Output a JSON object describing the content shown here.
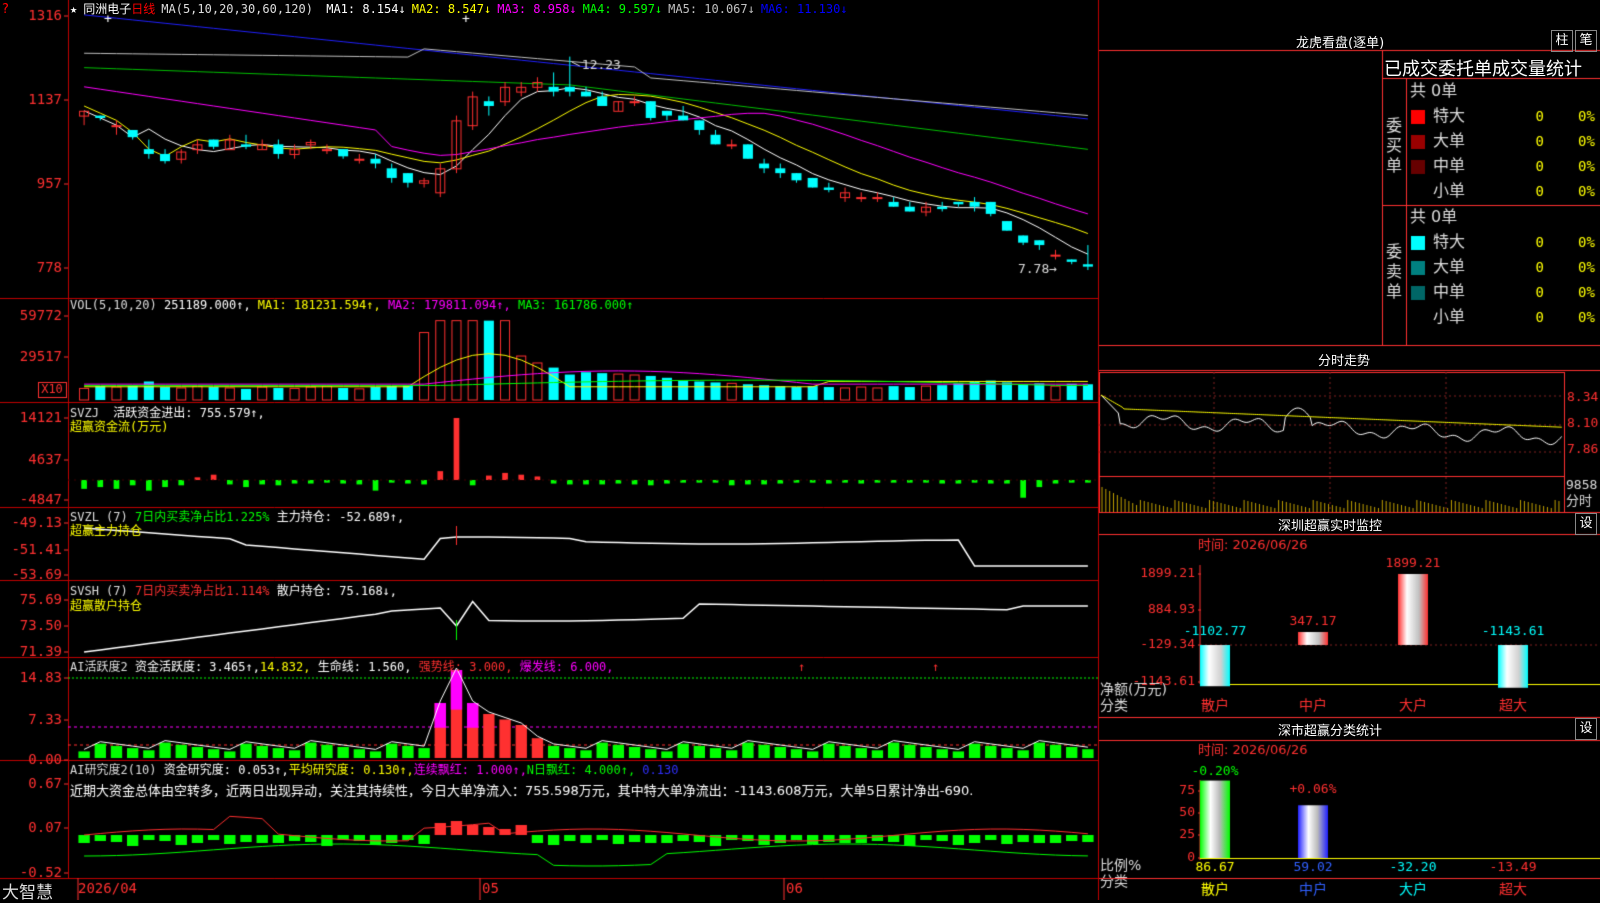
{
  "app": {
    "logo": "大智慧",
    "corner_mark": "?"
  },
  "header": {
    "stock_name": "同洲电子",
    "period": "日线",
    "ma_label": "MA(5,10,20,30,60,120)",
    "ma_values": [
      {
        "name": "MA1",
        "value": "8.154",
        "color": "#ffffff"
      },
      {
        "name": "MA2",
        "value": "8.547",
        "color": "#ffff00"
      },
      {
        "name": "MA3",
        "value": "8.958",
        "color": "#ff00ff"
      },
      {
        "name": "MA4",
        "value": "9.597",
        "color": "#00ff00"
      },
      {
        "name": "MA5",
        "value": "10.067",
        "color": "#c0c0c0"
      },
      {
        "name": "MA6",
        "value": "11.130",
        "color": "#0000ff"
      }
    ]
  },
  "panels": {
    "price": {
      "ticks": [
        "1316",
        "1137",
        "957",
        "778"
      ],
      "high_label": "12.23",
      "low_label": "7.78"
    },
    "vol": {
      "label": "VOL(5,10,20)",
      "value": "251189.000",
      "ma1": "MA1: 181231.594",
      "ma2": "MA2: 179811.094",
      "ma3": "MA3: 161786.000",
      "ticks": [
        "59772",
        "29517"
      ],
      "unit_badge": "X10"
    },
    "svzj": {
      "label": "SVZJ",
      "text": "活跃资金进出: 755.579",
      "sub": "超赢资金流(万元)",
      "ticks": [
        "14121",
        "4637",
        "-4847"
      ]
    },
    "svzl": {
      "label": "SVZL (7)",
      "text1": "7日内买卖净占比1.225%",
      "text2": "主力持仓: -52.689",
      "sub": "超赢主力持仓",
      "ticks": [
        "-49.13",
        "-51.41",
        "-53.69"
      ]
    },
    "svsh": {
      "label": "SVSH (7)",
      "text1": "7日内买卖净占比1.114%",
      "text2": "散户持仓: 75.168",
      "sub": "超赢散户持仓",
      "ticks": [
        "75.69",
        "73.50",
        "71.39"
      ]
    },
    "ai_active": {
      "label": "AI活跃度2",
      "text1": "资金活跃度: 3.465",
      "text2": "14.832,",
      "text3": "生命线: 1.560,",
      "text4": "强势线: 3.000,",
      "text5": "爆发线: 6.000,",
      "ticks": [
        "14.83",
        "7.33",
        "0.00"
      ]
    },
    "ai_research": {
      "label": "AI研究度2(10)",
      "text1": "资金研究度: 0.053",
      "text2": "平均研究度: 0.130",
      "text3": "连续飘红: 1.000",
      "text4": "N日飘红: 4.000",
      "text5": "0.130",
      "comment": "近期大资金总体由空转多，近两日出现异动，关注其持续性，今日大单净流入：755.598万元，其中特大单净流出：-1143.608万元，大单5日累计净出-690.",
      "ticks": [
        "0.67",
        "0.07",
        "-0.52"
      ]
    }
  },
  "xaxis": {
    "labels": [
      "2026/04",
      "05",
      "06"
    ]
  },
  "right": {
    "lhb": {
      "title": "龙虎看盘(逐单)",
      "btn1": "柱",
      "btn2": "笔",
      "sub_title": "已成交委托单成交量统计",
      "buy": {
        "side_label": "委买单",
        "total": "共 0单",
        "rows": [
          {
            "name": "特大",
            "value": "0",
            "pct": "0%",
            "color": "#ff0000"
          },
          {
            "name": "大单",
            "value": "0",
            "pct": "0%",
            "color": "#990000"
          },
          {
            "name": "中单",
            "value": "0",
            "pct": "0%",
            "color": "#660000"
          },
          {
            "name": "小单",
            "value": "0",
            "pct": "0%",
            "color": ""
          }
        ]
      },
      "sell": {
        "side_label": "委卖单",
        "total": "共 0单",
        "rows": [
          {
            "name": "特大",
            "value": "0",
            "pct": "0%",
            "color": "#00ffff"
          },
          {
            "name": "大单",
            "value": "0",
            "pct": "0%",
            "color": "#008080"
          },
          {
            "name": "中单",
            "value": "0",
            "pct": "0%",
            "color": "#006666"
          },
          {
            "name": "小单",
            "value": "0",
            "pct": "0%",
            "color": ""
          }
        ]
      }
    },
    "fenshi": {
      "title": "分时走势",
      "ticks": [
        "8.34",
        "8.10",
        "7.86"
      ],
      "vol_tick": "9858",
      "vol_unit": "分时"
    },
    "sz_monitor": {
      "title": "深圳超赢实时监控",
      "btn": "设",
      "time": "时间: 2026/06/26",
      "ticks": [
        "1899.21",
        "884.93",
        "-129.34",
        "-1143.61"
      ],
      "axis_label1": "净额(万元)",
      "axis_label2": "分类",
      "bars": [
        {
          "cat": "散户",
          "value": -1102.77,
          "label": "-1102.77"
        },
        {
          "cat": "中户",
          "value": 347.17,
          "label": "347.17"
        },
        {
          "cat": "大户",
          "value": 1899.21,
          "label": "1899.21"
        },
        {
          "cat": "超大",
          "value": -1143.61,
          "label": "-1143.61"
        }
      ]
    },
    "sz_stats": {
      "title": "深市超赢分类统计",
      "btn": "设",
      "time": "时间: 2026/06/26",
      "ticks": [
        "75",
        "50",
        "25",
        "0"
      ],
      "axis_label1": "比例%",
      "axis_label2": "分类",
      "bars": [
        {
          "cat": "散户",
          "value": 86.67,
          "label": "86.67",
          "delta": "-0.20%"
        },
        {
          "cat": "中户",
          "value": 59.02,
          "label": "59.02",
          "delta": "+0.06%"
        },
        {
          "cat": "大户",
          "value": -32.2,
          "label": "-32.20",
          "delta": ""
        },
        {
          "cat": "超大",
          "value": -13.49,
          "label": "-13.49",
          "delta": ""
        }
      ]
    }
  },
  "chart_data": {
    "type": "candlestick",
    "candles": [
      [
        11.0,
        11.1,
        10.8,
        11.1
      ],
      [
        11.0,
        11.0,
        10.9,
        10.95
      ],
      [
        10.8,
        10.9,
        10.6,
        10.8
      ],
      [
        10.7,
        10.7,
        10.5,
        10.55
      ],
      [
        10.3,
        10.5,
        10.1,
        10.2
      ],
      [
        10.2,
        10.3,
        10.0,
        10.05
      ],
      [
        10.1,
        10.3,
        10.0,
        10.25
      ],
      [
        10.3,
        10.5,
        10.2,
        10.4
      ],
      [
        10.5,
        10.5,
        10.3,
        10.35
      ],
      [
        10.3,
        10.6,
        10.3,
        10.5
      ],
      [
        10.4,
        10.6,
        10.3,
        10.35
      ],
      [
        10.3,
        10.5,
        10.3,
        10.4
      ],
      [
        10.4,
        10.5,
        10.1,
        10.2
      ],
      [
        10.2,
        10.4,
        10.1,
        10.3
      ],
      [
        10.4,
        10.5,
        10.3,
        10.45
      ],
      [
        10.3,
        10.4,
        10.2,
        10.3
      ],
      [
        10.3,
        10.3,
        10.1,
        10.15
      ],
      [
        10.1,
        10.2,
        10.0,
        10.1
      ],
      [
        10.1,
        10.2,
        9.9,
        10.0
      ],
      [
        9.9,
        10.0,
        9.6,
        9.7
      ],
      [
        9.8,
        9.8,
        9.5,
        9.6
      ],
      [
        9.6,
        9.7,
        9.5,
        9.65
      ],
      [
        9.4,
        10.0,
        9.3,
        9.9
      ],
      [
        9.9,
        11.0,
        9.8,
        10.9
      ],
      [
        10.8,
        11.5,
        10.7,
        11.4
      ],
      [
        11.3,
        11.4,
        11.0,
        11.2
      ],
      [
        11.3,
        11.7,
        11.2,
        11.6
      ],
      [
        11.5,
        11.7,
        11.4,
        11.6
      ],
      [
        11.6,
        11.8,
        11.5,
        11.7
      ],
      [
        11.6,
        11.9,
        11.4,
        11.5
      ],
      [
        11.6,
        12.23,
        11.4,
        11.5
      ],
      [
        11.5,
        11.6,
        11.4,
        11.4
      ],
      [
        11.4,
        11.5,
        11.2,
        11.2
      ],
      [
        11.1,
        11.3,
        11.1,
        11.3
      ],
      [
        11.3,
        11.4,
        11.2,
        11.3
      ],
      [
        11.3,
        11.3,
        10.9,
        10.95
      ],
      [
        11.1,
        11.1,
        10.9,
        11.0
      ],
      [
        11.0,
        11.2,
        10.9,
        10.9
      ],
      [
        10.9,
        10.9,
        10.6,
        10.7
      ],
      [
        10.6,
        10.7,
        10.4,
        10.4
      ],
      [
        10.4,
        10.5,
        10.3,
        10.4
      ],
      [
        10.4,
        10.4,
        10.1,
        10.1
      ],
      [
        10.0,
        10.1,
        9.8,
        9.9
      ],
      [
        9.9,
        10.0,
        9.7,
        9.8
      ],
      [
        9.8,
        9.8,
        9.6,
        9.65
      ],
      [
        9.7,
        9.7,
        9.5,
        9.5
      ],
      [
        9.5,
        9.6,
        9.4,
        9.45
      ],
      [
        9.3,
        9.5,
        9.2,
        9.4
      ],
      [
        9.3,
        9.4,
        9.2,
        9.3
      ],
      [
        9.3,
        9.4,
        9.2,
        9.3
      ],
      [
        9.2,
        9.3,
        9.1,
        9.1
      ],
      [
        9.1,
        9.2,
        9.0,
        9.0
      ],
      [
        9.0,
        9.2,
        8.9,
        9.1
      ],
      [
        9.1,
        9.2,
        9.0,
        9.05
      ],
      [
        9.2,
        9.2,
        9.1,
        9.15
      ],
      [
        9.2,
        9.3,
        9.0,
        9.1
      ],
      [
        9.2,
        9.2,
        8.9,
        8.95
      ],
      [
        8.8,
        8.8,
        8.6,
        8.6
      ],
      [
        8.5,
        8.5,
        8.3,
        8.35
      ],
      [
        8.4,
        8.4,
        8.2,
        8.3
      ],
      [
        8.1,
        8.2,
        8.0,
        8.1
      ],
      [
        8.0,
        8.0,
        7.9,
        7.95
      ],
      [
        7.9,
        8.3,
        7.78,
        7.85
      ]
    ]
  }
}
